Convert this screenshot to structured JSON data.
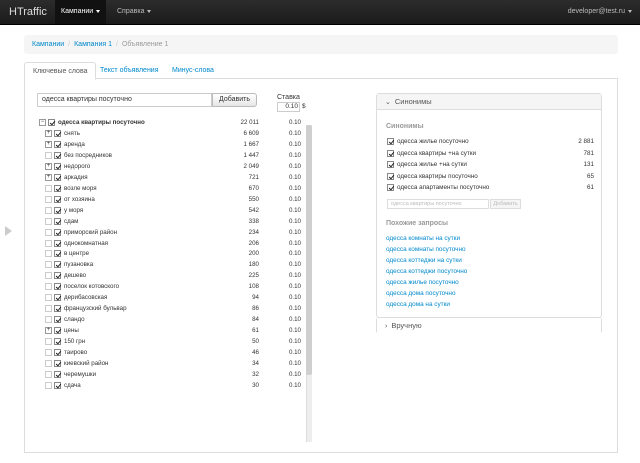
{
  "navbar": {
    "brand": "HTraffic",
    "items": [
      {
        "label": "Кампании"
      },
      {
        "label": "Справка"
      }
    ],
    "user": "developer@test.ru"
  },
  "breadcrumb": {
    "items": [
      "Кампании",
      "Кампания 1",
      "Объявление 1"
    ]
  },
  "tabs": [
    {
      "label": "Ключевые слова"
    },
    {
      "label": "Текст объявления"
    },
    {
      "label": "Минус-слова"
    }
  ],
  "keywords": {
    "search_value": "одесса квартиры посуточно",
    "add_label": "Добавить",
    "bid_label": "Ставка",
    "bid_value": "0.10",
    "bid_unit": "$",
    "root": {
      "text": "одесса квартиры посуточно",
      "count": "22 011",
      "rate": "0.10",
      "toggle": "−"
    },
    "rows": [
      {
        "text": "снять",
        "count": "6 609",
        "rate": "0.10",
        "toggle": "+"
      },
      {
        "text": "аренда",
        "count": "1 667",
        "rate": "0.10",
        "toggle": "+"
      },
      {
        "text": "без посредников",
        "count": "1 447",
        "rate": "0.10",
        "toggle": ""
      },
      {
        "text": "недорого",
        "count": "2 049",
        "rate": "0.10",
        "toggle": "+"
      },
      {
        "text": "аркадия",
        "count": "721",
        "rate": "0.10",
        "toggle": "+"
      },
      {
        "text": "возле моря",
        "count": "670",
        "rate": "0.10",
        "toggle": ""
      },
      {
        "text": "от хозяина",
        "count": "550",
        "rate": "0.10",
        "toggle": ""
      },
      {
        "text": "у моря",
        "count": "542",
        "rate": "0.10",
        "toggle": ""
      },
      {
        "text": "сдам",
        "count": "338",
        "rate": "0.10",
        "toggle": ""
      },
      {
        "text": "приморский район",
        "count": "234",
        "rate": "0.10",
        "toggle": ""
      },
      {
        "text": "однокомнатная",
        "count": "206",
        "rate": "0.10",
        "toggle": ""
      },
      {
        "text": "в центре",
        "count": "200",
        "rate": "0.10",
        "toggle": ""
      },
      {
        "text": "пузановка",
        "count": "180",
        "rate": "0.10",
        "toggle": ""
      },
      {
        "text": "дешево",
        "count": "225",
        "rate": "0.10",
        "toggle": ""
      },
      {
        "text": "поселок котовского",
        "count": "108",
        "rate": "0.10",
        "toggle": ""
      },
      {
        "text": "дерибасовская",
        "count": "94",
        "rate": "0.10",
        "toggle": ""
      },
      {
        "text": "французский бульвар",
        "count": "86",
        "rate": "0.10",
        "toggle": ""
      },
      {
        "text": "сландо",
        "count": "84",
        "rate": "0.10",
        "toggle": ""
      },
      {
        "text": "цены",
        "count": "61",
        "rate": "0.10",
        "toggle": "+"
      },
      {
        "text": "150 грн",
        "count": "50",
        "rate": "0.10",
        "toggle": ""
      },
      {
        "text": "таирово",
        "count": "46",
        "rate": "0.10",
        "toggle": ""
      },
      {
        "text": "киевский район",
        "count": "34",
        "rate": "0.10",
        "toggle": ""
      },
      {
        "text": "черемушки",
        "count": "32",
        "rate": "0.10",
        "toggle": ""
      },
      {
        "text": "сдача",
        "count": "30",
        "rate": "0.10",
        "toggle": ""
      }
    ]
  },
  "synonyms_panel": {
    "title": "Синонимы",
    "section_title": "Синонимы",
    "items": [
      {
        "text": "одесса жилье посуточно",
        "count": "2 881"
      },
      {
        "text": "одесса квартиры +на сутки",
        "count": "781"
      },
      {
        "text": "одесса жилье +на сутки",
        "count": "131"
      },
      {
        "text": "одесса квартиры посуточно",
        "count": "65"
      },
      {
        "text": "одесса апартаменты посуточно",
        "count": "61"
      }
    ],
    "input_placeholder": "одесса квартиры посуточно",
    "add_label": "Добавить",
    "similar_title": "Похожие запросы",
    "similar": [
      "одесса комнаты на сутки",
      "одесса комнаты посуточно",
      "одесса коттеджи на сутки",
      "одесса коттеджи посуточно",
      "одесса жилье посуточно",
      "одесса дома посуточно",
      "одесса дома на сутки"
    ]
  },
  "manual_panel": {
    "title": "Вручную"
  }
}
